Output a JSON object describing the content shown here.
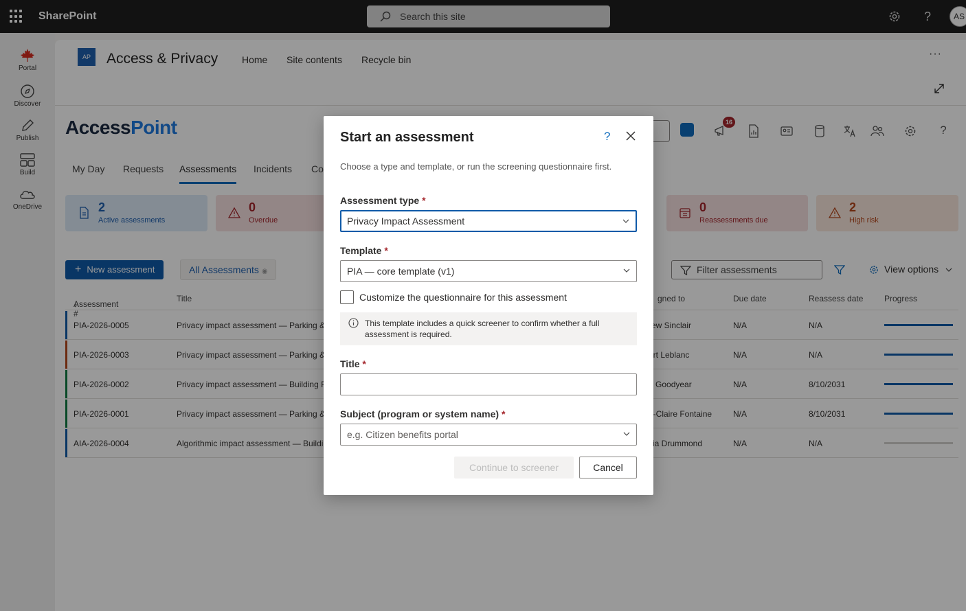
{
  "suite": {
    "brand": "SharePoint",
    "search_placeholder": "Search this site",
    "avatar": "AS"
  },
  "rail": {
    "items": [
      {
        "label": "Portal",
        "icon": "maple-leaf-icon"
      },
      {
        "label": "Discover",
        "icon": "compass-icon"
      },
      {
        "label": "Publish",
        "icon": "pen-icon"
      },
      {
        "label": "Build",
        "icon": "layout-icon"
      },
      {
        "label": "OneDrive",
        "icon": "cloud-icon"
      }
    ]
  },
  "site": {
    "logo": "AP",
    "title": "Access & Privacy",
    "nav": [
      "Home",
      "Site contents",
      "Recycle bin"
    ],
    "more": "···"
  },
  "app": {
    "logo_a": "Access",
    "logo_b": "Point",
    "badge_count": "16",
    "tabs": [
      "My Day",
      "Requests",
      "Assessments",
      "Incidents",
      "Co"
    ],
    "active_tab": "Assessments",
    "stats": [
      {
        "num": "2",
        "label": "Active assessments",
        "color": "#1f5fae",
        "bg": "#dce9f7"
      },
      {
        "num": "0",
        "label": "Overdue",
        "color": "#a4262c",
        "bg": "#f6e0e0"
      },
      {
        "num": "0",
        "label": "Reassessments due",
        "color": "#a4262c",
        "bg": "#f6e0e0"
      },
      {
        "num": "2",
        "label": "High risk",
        "color": "#b5461c",
        "bg": "#f9e6dc"
      }
    ],
    "new_button": "New assessment",
    "view_tab": "All Assessments",
    "filter_placeholder": "Filter assessments",
    "view_options": "View options",
    "table": {
      "headers": [
        "Assessment #",
        "Title",
        "gned to",
        "Due date",
        "Reassess date",
        "Progress"
      ],
      "rows": [
        {
          "id": "PIA-2026-0005",
          "title": "Privacy impact assessment — Parking &",
          "assigned": "rew Sinclair",
          "due": "N/A",
          "reassess": "N/A",
          "progress": 1.0,
          "accent": "#0f5aa8"
        },
        {
          "id": "PIA-2026-0003",
          "title": "Privacy impact assessment — Parking &",
          "assigned": "ert Leblanc",
          "due": "N/A",
          "reassess": "N/A",
          "progress": 1.0,
          "accent": "#b5461c"
        },
        {
          "id": "PIA-2026-0002",
          "title": "Privacy impact assessment — Building Pe",
          "assigned": "e Goodyear",
          "due": "N/A",
          "reassess": "8/10/2031",
          "progress": 1.0,
          "accent": "#107c41"
        },
        {
          "id": "PIA-2026-0001",
          "title": "Privacy impact assessment — Parking &",
          "assigned": "e-Claire Fontaine",
          "due": "N/A",
          "reassess": "8/10/2031",
          "progress": 1.0,
          "accent": "#107c41"
        },
        {
          "id": "AIA-2026-0004",
          "title": "Algorithmic impact assessment — Buildi",
          "assigned": "cia Drummond",
          "due": "N/A",
          "reassess": "N/A",
          "progress": 0.0,
          "accent": "#0f5aa8"
        }
      ]
    }
  },
  "dialog": {
    "title": "Start an assessment",
    "help": "?",
    "subtitle": "Choose a type and template, or run the screening questionnaire first.",
    "type_label": "Assessment type",
    "type_value": "Privacy Impact Assessment",
    "template_label": "Template",
    "template_value": "PIA — core template (v1)",
    "customize_label": "Customize the questionnaire for this assessment",
    "info_text": "This template includes a quick screener to confirm whether a full assessment is required.",
    "title_label": "Title",
    "title_value": "",
    "subject_label": "Subject (program or system name)",
    "subject_placeholder": "e.g. Citizen benefits portal",
    "required_mark": "*",
    "continue_label": "Continue to screener",
    "cancel_label": "Cancel"
  }
}
